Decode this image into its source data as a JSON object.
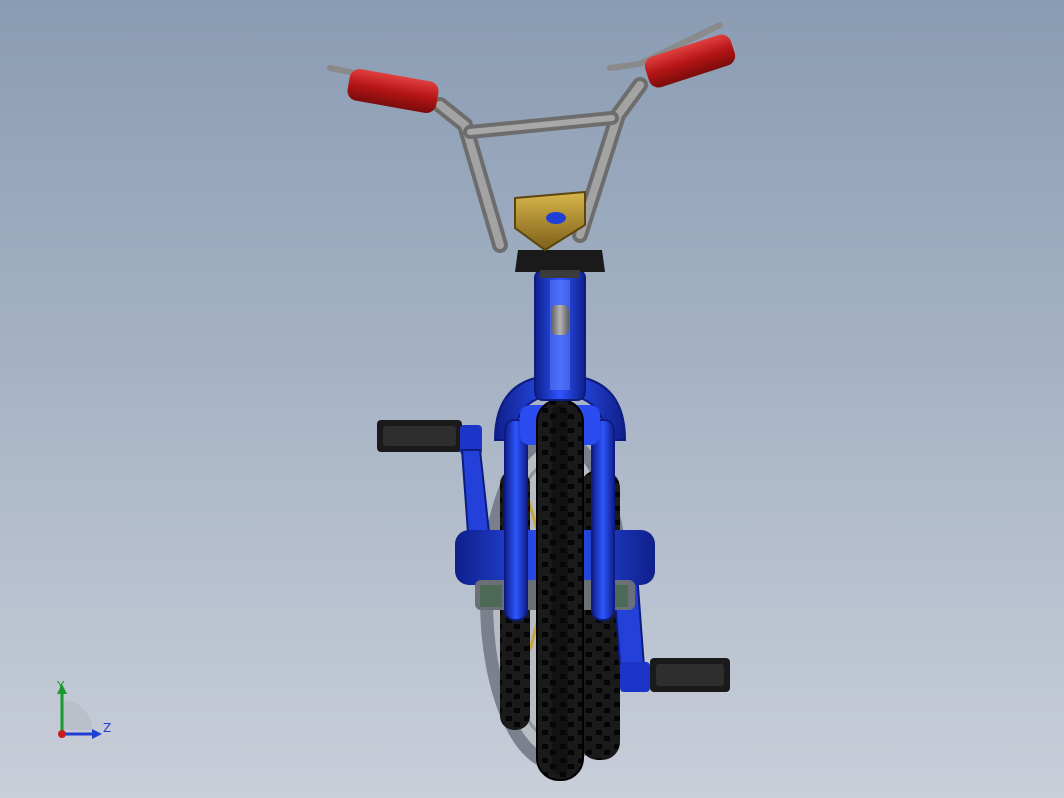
{
  "colors": {
    "background_top": "#8a9cb3",
    "background_bottom": "#c9cfd9",
    "frame_blue": "#1f3fd6",
    "grip_red": "#c41a1a",
    "bar_gray": "#8f8f8f",
    "stem_gold": "#b5912e",
    "tire_black": "#151515",
    "axis_x": "#c81e1e",
    "axis_y": "#1a9a2a",
    "axis_z": "#1e3fd2"
  },
  "triad": {
    "y_label": "Y",
    "z_label": "Z"
  }
}
